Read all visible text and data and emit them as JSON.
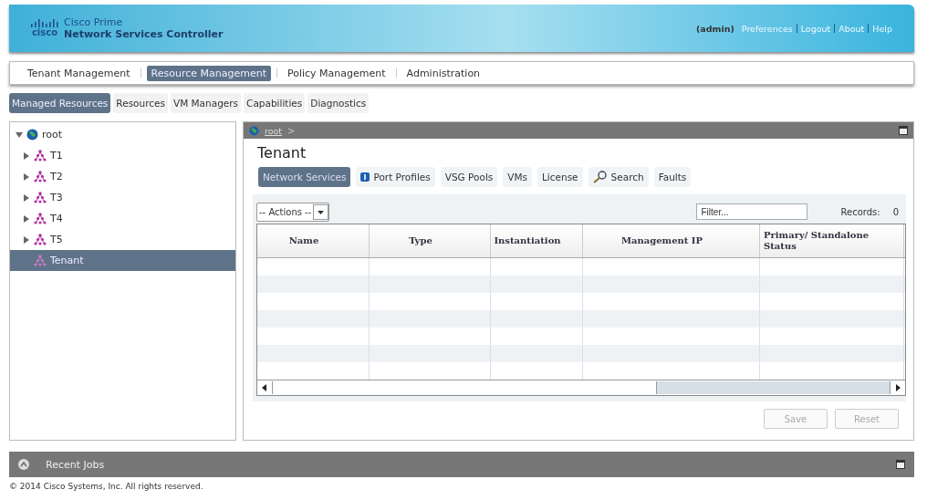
{
  "header": {
    "logo_text": "cisco",
    "product_line1": "Cisco Prime",
    "product_line2": "Network Services Controller",
    "user": "(admin)",
    "links": [
      "Preferences",
      "Logout",
      "About",
      "Help"
    ]
  },
  "nav_tabs": [
    {
      "label": "Tenant Management",
      "selected": false
    },
    {
      "label": "Resource Management",
      "selected": true
    },
    {
      "label": "Policy Management",
      "selected": false
    },
    {
      "label": "Administration",
      "selected": false
    }
  ],
  "sub_tabs": [
    {
      "label": "Managed Resources",
      "selected": true
    },
    {
      "label": "Resources",
      "selected": false
    },
    {
      "label": "VM Managers",
      "selected": false
    },
    {
      "label": "Capabilities",
      "selected": false
    },
    {
      "label": "Diagnostics",
      "selected": false
    }
  ],
  "tree": [
    {
      "label": "root",
      "kind": "globe",
      "expanded": true,
      "selected": false,
      "children": [
        {
          "label": "T1",
          "kind": "tenant",
          "expanded": false,
          "selected": false
        },
        {
          "label": "T2",
          "kind": "tenant",
          "expanded": false,
          "selected": false
        },
        {
          "label": "T3",
          "kind": "tenant",
          "expanded": false,
          "selected": false
        },
        {
          "label": "T4",
          "kind": "tenant",
          "expanded": false,
          "selected": false
        },
        {
          "label": "T5",
          "kind": "tenant",
          "expanded": false,
          "selected": false
        },
        {
          "label": "Tenant",
          "kind": "leaf",
          "selected": true
        }
      ]
    }
  ],
  "panel": {
    "breadcrumb": "root",
    "breadcrumb_separator": ">",
    "title": "Tenant",
    "tabs": [
      {
        "label": "Network Services",
        "selected": true,
        "kind": "plain"
      },
      {
        "label": "Port Profiles",
        "selected": false,
        "kind": "info"
      },
      {
        "label": "VSG Pools",
        "selected": false,
        "kind": "plain"
      },
      {
        "label": "VMs",
        "selected": false,
        "kind": "plain"
      },
      {
        "label": "License",
        "selected": false,
        "kind": "plain"
      },
      {
        "label": "Search",
        "selected": false,
        "kind": "search"
      },
      {
        "label": "Faults",
        "selected": false,
        "kind": "plain"
      }
    ],
    "actions": "-- Actions --",
    "filter_placeholder": "Filter...",
    "records_label": "Records:",
    "records_value": "0",
    "columns": [
      "Name",
      "Type",
      "Instantiation",
      "Management IP",
      "Primary/ Standalone Status"
    ],
    "buttons": [
      {
        "label": "Save",
        "disabled": true
      },
      {
        "label": "Reset",
        "disabled": true
      }
    ]
  },
  "bottom_panel": {
    "title": "Recent Jobs"
  },
  "footer": "© 2014 Cisco Systems, Inc. All rights reserved."
}
